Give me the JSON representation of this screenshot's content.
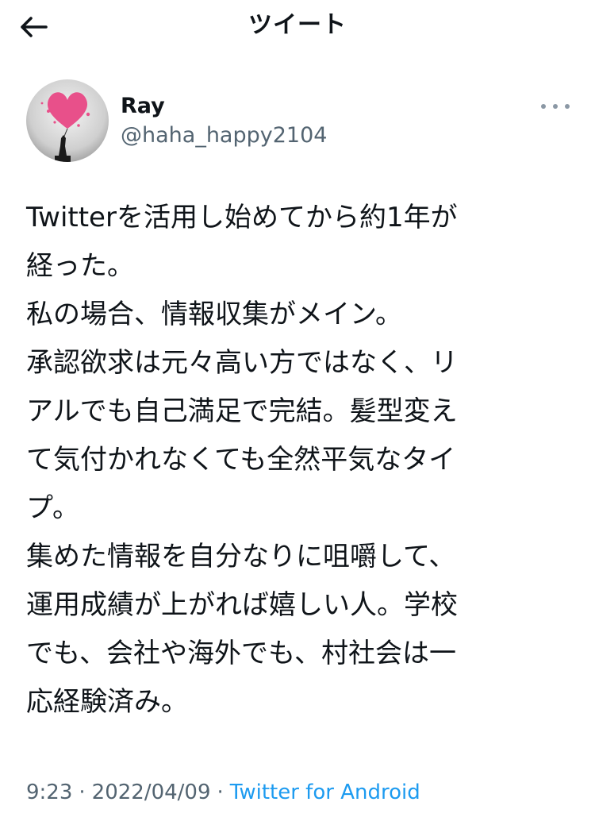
{
  "header": {
    "title": "ツイート"
  },
  "author": {
    "name": "Ray",
    "handle": "@haha_happy2104"
  },
  "tweet": {
    "lines": [
      "Twitterを活用し始めてから約1年が",
      "経った。",
      "私の場合、情報収集がメイン。",
      "承認欲求は元々高い方ではなく、リ",
      "アルでも自己満足で完結。髪型変え",
      "て気付かれなくても全然平気なタイ",
      "プ。",
      "集めた情報を自分なりに咀嚼して、",
      "運用成績が上がれば嬉しい人。学校",
      "でも、会社や海外でも、村社会は一",
      "応経験済み。"
    ]
  },
  "meta": {
    "time": "9:23",
    "separator": "·",
    "date": "2022/04/09",
    "source": "Twitter for Android"
  },
  "colors": {
    "text": "#0f1419",
    "secondary": "#536471",
    "link": "#1d9bf0",
    "avatar_heart": "#e8508a"
  },
  "icons": {
    "back": "arrow-left-icon",
    "more": "more-horizontal-icon",
    "avatar_image": "heart-balloon-statue"
  }
}
